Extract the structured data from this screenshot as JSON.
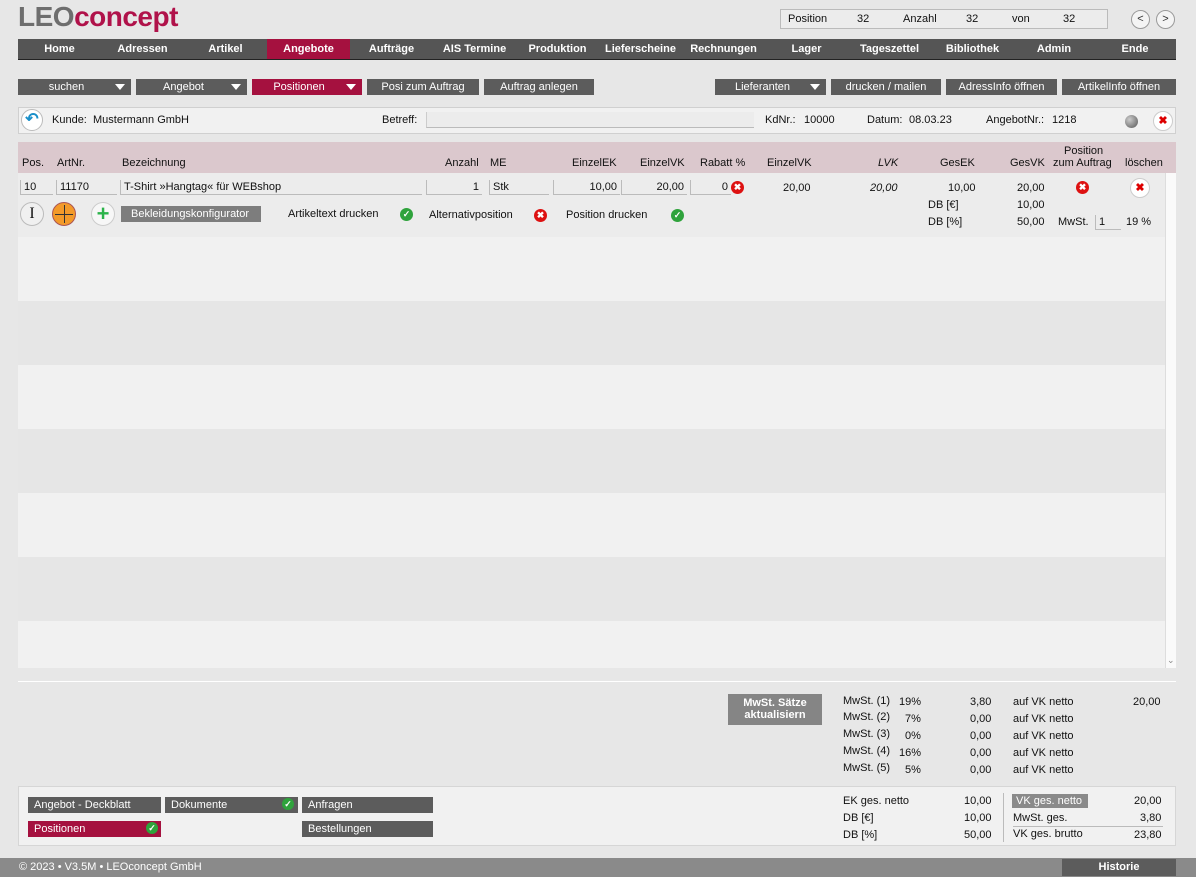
{
  "logo": {
    "part1": "LEO",
    "part2": "concept"
  },
  "counter": {
    "position_label": "Position",
    "position_value": "32",
    "anzahl_label": "Anzahl",
    "anzahl_value": "32",
    "von_label": "von",
    "von_value": "32",
    "prev": "<",
    "next": ">"
  },
  "nav": [
    "Home",
    "Adressen",
    "Artikel",
    "Angebote",
    "Aufträge",
    "AIS Termine",
    "Produktion",
    "Lieferscheine",
    "Rechnungen",
    "Lager",
    "Tageszettel",
    "Bibliothek",
    "Admin",
    "Ende"
  ],
  "toolbar": {
    "suchen": "suchen",
    "angebot": "Angebot",
    "positionen": "Positionen",
    "posi_zum_auftrag": "Posi zum Auftrag",
    "auftrag_anlegen": "Auftrag anlegen",
    "lieferanten": "Lieferanten",
    "drucken_mailen": "drucken / mailen",
    "adressinfo": "AdressInfo öffnen",
    "artikelinfo": "ArtikelInfo öffnen"
  },
  "header": {
    "kunde_label": "Kunde:",
    "kunde_value": "Mustermann GmbH",
    "betreff_label": "Betreff:",
    "betreff_value": "",
    "kdnr_label": "KdNr.:",
    "kdnr_value": "10000",
    "datum_label": "Datum:",
    "datum_value": "08.03.23",
    "angebotnr_label": "AngebotNr.:",
    "angebotnr_value": "1218"
  },
  "columns": {
    "pos": "Pos.",
    "artnr": "ArtNr.",
    "bezeichnung": "Bezeichnung",
    "anzahl": "Anzahl",
    "me": "ME",
    "einzelek": "EinzelEK",
    "einzelvk": "EinzelVK",
    "rabatt": "Rabatt %",
    "einzelvk2": "EinzelVK",
    "lvk": "LVK",
    "gesek": "GesEK",
    "gesvk": "GesVK",
    "pos_auftrag_1": "Position",
    "pos_auftrag_2": "zum Auftrag",
    "loeschen": "löschen"
  },
  "row": {
    "pos": "10",
    "artnr": "11170",
    "bezeichnung": "T-Shirt »Hangtag« für WEBshop",
    "anzahl": "1",
    "me": "Stk",
    "einzelek": "10,00",
    "einzelvk": "20,00",
    "rabatt": "0",
    "einzelvk2": "20,00",
    "lvk": "20,00",
    "gesek": "10,00",
    "gesvk": "20,00",
    "db_eur_label": "DB [€]",
    "db_eur_value": "10,00",
    "db_pct_label": "DB [%]",
    "db_pct_value": "50,00",
    "mwst_label": "MwSt.",
    "mwst_code": "1",
    "mwst_rate": "19 %",
    "konfigurator": "Bekleidungskonfigurator",
    "artikeltext": "Artikeltext drucken",
    "alternativ": "Alternativposition",
    "position_drucken": "Position drucken"
  },
  "mwst_button": {
    "line1": "MwSt. Sätze",
    "line2": "aktualisiern"
  },
  "mwst_table": [
    {
      "label": "MwSt. (1)",
      "rate": "19%",
      "amount": "3,80",
      "basis": "auf VK netto",
      "netto": "20,00"
    },
    {
      "label": "MwSt. (2)",
      "rate": "7%",
      "amount": "0,00",
      "basis": "auf VK netto",
      "netto": ""
    },
    {
      "label": "MwSt. (3)",
      "rate": "0%",
      "amount": "0,00",
      "basis": "auf VK netto",
      "netto": ""
    },
    {
      "label": "MwSt. (4)",
      "rate": "16%",
      "amount": "0,00",
      "basis": "auf VK netto",
      "netto": ""
    },
    {
      "label": "MwSt. (5)",
      "rate": "5%",
      "amount": "0,00",
      "basis": "auf VK netto",
      "netto": ""
    }
  ],
  "bottom_buttons": {
    "deckblatt": "Angebot - Deckblatt",
    "dokumente": "Dokumente",
    "anfragen": "Anfragen",
    "positionen": "Positionen",
    "bestellungen": "Bestellungen"
  },
  "totals_left": [
    {
      "label": "EK ges. netto",
      "value": "10,00"
    },
    {
      "label": "DB [€]",
      "value": "10,00"
    },
    {
      "label": "DB [%]",
      "value": "50,00"
    }
  ],
  "totals_right": [
    {
      "label": "VK ges. netto",
      "value": "20,00"
    },
    {
      "label": "MwSt. ges.",
      "value": "3,80"
    },
    {
      "label": "VK ges. brutto",
      "value": "23,80"
    }
  ],
  "footer": {
    "copyright": "© 2023 • V3.5M • LEOconcept GmbH",
    "historie": "Historie"
  },
  "colors": {
    "accent": "#a5113f",
    "nav": "#555555",
    "header_row": "#dbc8cd"
  }
}
